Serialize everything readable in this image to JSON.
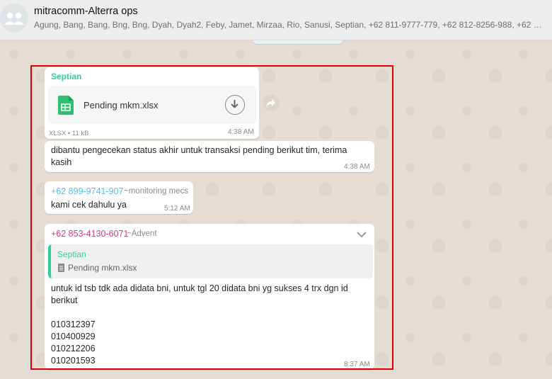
{
  "header": {
    "title": "mitracomm-Alterra ops",
    "subtitle": "Agung, Bang, Bang, Bng, Bng, Dyah, Dyah2, Feby, Jamet, Mirzaa, Rio, Sanusi, Septian, +62 811-9777-779, +62 812-8256-988, +62 812-9..."
  },
  "messages": {
    "file_msg": {
      "sender": "Septian",
      "file_name": "Pending mkm.xlsx",
      "file_meta": "XLSX • 11 kB",
      "time": "4:38 AM"
    },
    "text_msg": {
      "line1": "dibantu pengecekan status akhir untuk transaksi pending berikut tim, terima",
      "line2": "kasih",
      "time": "4:38 AM"
    },
    "monitoring_msg": {
      "sender": "+62 899-9741-907",
      "alias": "~monitoring mecs",
      "text": "kami cek dahulu ya",
      "time": "5:12 AM"
    },
    "reply_msg": {
      "sender": "+62 853-4130-6071",
      "alias": "~Advent",
      "quote_sender": "Septian",
      "quote_file": "Pending mkm.xlsx",
      "line1": "untuk id tsb tdk ada didata bni,  untuk tgl 20 didata bni yg sukses 4 trx dgn id",
      "line2": "berikut",
      "ids": [
        "010312397",
        "010400929",
        "010212206",
        "010201593"
      ],
      "time": "8:37 AM"
    }
  },
  "colors": {
    "septian": "#35cd96",
    "monitoring": "#53bdeb",
    "advent": "#d83b84",
    "highlight": "#e00000"
  }
}
